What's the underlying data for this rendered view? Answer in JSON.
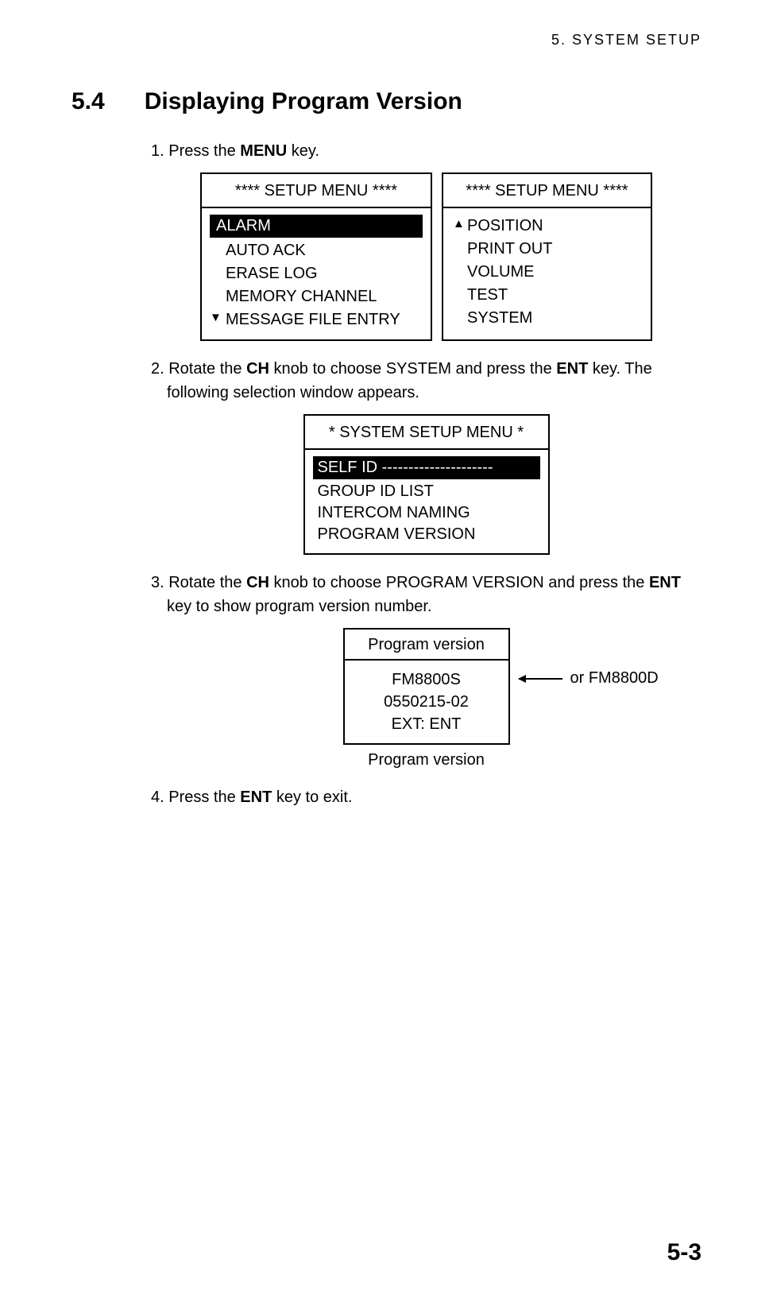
{
  "header": {
    "chapter": "5.  SYSTEM  SETUP"
  },
  "section": {
    "number": "5.4",
    "title": "Displaying Program Version"
  },
  "steps": {
    "s1_prefix": "1. Press the ",
    "s1_bold": "MENU",
    "s1_suffix": " key.",
    "s2_prefix": "2. Rotate the ",
    "s2_bold1": "CH",
    "s2_mid": " knob to choose SYSTEM and press the ",
    "s2_bold2": "ENT",
    "s2_suffix": " key. The following selection window appears.",
    "s3_prefix": "3. Rotate the ",
    "s3_bold1": "CH",
    "s3_mid": " knob to choose PROGRAM VERSION and press the ",
    "s3_bold2": "ENT",
    "s3_suffix": " key to show program version number.",
    "s4_prefix": "4. Press the ",
    "s4_bold": "ENT",
    "s4_suffix": " key to exit."
  },
  "menu1": {
    "title": "**** SETUP MENU ****",
    "items": {
      "i1": "ALARM",
      "i2": "AUTO  ACK",
      "i3": "ERASE  LOG",
      "i4": "MEMORY CHANNEL",
      "i5": "MESSAGE FILE ENTRY"
    },
    "down_arrow": "▼"
  },
  "menu2": {
    "title": "**** SETUP MENU ****",
    "items": {
      "i1": "POSITION",
      "i2": "PRINT OUT",
      "i3": "VOLUME",
      "i4": "TEST",
      "i5": "SYSTEM"
    },
    "up_arrow": "▲"
  },
  "system_menu": {
    "title": "* SYSTEM SETUP MENU *",
    "items": {
      "i1": "SELF ID ---------------------",
      "i2": "GROUP ID LIST",
      "i3": "INTERCOM NAMING",
      "i4": "PROGRAM VERSION"
    }
  },
  "program_version": {
    "title": "Program version",
    "line1": "FM8800S",
    "line2": "0550215-02",
    "line3": "EXT: ENT",
    "annotation": "or FM8800D",
    "caption": "Program version"
  },
  "footer": {
    "page": "5-3"
  }
}
